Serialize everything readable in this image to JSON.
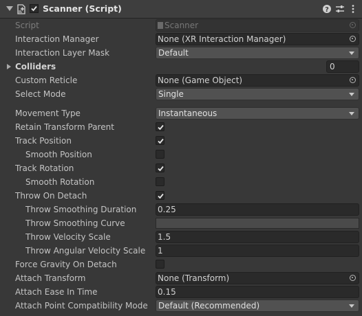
{
  "component": {
    "title": "Scanner (Script)",
    "enabled": true,
    "icon": "script-component-icon",
    "header_buttons": [
      "help-icon",
      "preset-icon",
      "context-menu-icon"
    ]
  },
  "rows": [
    {
      "name": "script",
      "label": "Script",
      "kind": "object",
      "value": "Scanner",
      "dim": true,
      "indent": 0
    },
    {
      "name": "interaction-manager",
      "label": "Interaction Manager",
      "kind": "object",
      "value": "None (XR Interaction Manager)",
      "indent": 0
    },
    {
      "name": "interaction-layer-mask",
      "label": "Interaction Layer Mask",
      "kind": "dropdown",
      "value": "Default",
      "indent": 0
    },
    {
      "name": "colliders",
      "label": "Colliders",
      "kind": "foldout",
      "value": "0",
      "indent": 0
    },
    {
      "name": "custom-reticle",
      "label": "Custom Reticle",
      "kind": "object",
      "value": "None (Game Object)",
      "indent": 0
    },
    {
      "name": "select-mode",
      "label": "Select Mode",
      "kind": "dropdown",
      "value": "Single",
      "indent": 0
    },
    {
      "name": "movement-type",
      "label": "Movement Type",
      "kind": "dropdown",
      "value": "Instantaneous",
      "indent": 0
    },
    {
      "name": "retain-transform-parent",
      "label": "Retain Transform Parent",
      "kind": "checkbox",
      "checked": true,
      "indent": 0
    },
    {
      "name": "track-position",
      "label": "Track Position",
      "kind": "checkbox",
      "checked": true,
      "indent": 0
    },
    {
      "name": "smooth-position",
      "label": "Smooth Position",
      "kind": "checkbox",
      "checked": false,
      "indent": 1
    },
    {
      "name": "track-rotation",
      "label": "Track Rotation",
      "kind": "checkbox",
      "checked": true,
      "indent": 0
    },
    {
      "name": "smooth-rotation",
      "label": "Smooth Rotation",
      "kind": "checkbox",
      "checked": false,
      "indent": 1
    },
    {
      "name": "throw-on-detach",
      "label": "Throw On Detach",
      "kind": "checkbox",
      "checked": true,
      "indent": 0
    },
    {
      "name": "throw-smoothing-duration",
      "label": "Throw Smoothing Duration",
      "kind": "text",
      "value": "0.25",
      "indent": 1
    },
    {
      "name": "throw-smoothing-curve",
      "label": "Throw Smoothing Curve",
      "kind": "curve",
      "indent": 1
    },
    {
      "name": "throw-velocity-scale",
      "label": "Throw Velocity Scale",
      "kind": "text",
      "value": "1.5",
      "indent": 1
    },
    {
      "name": "throw-angular-velocity-scale",
      "label": "Throw Angular Velocity Scale",
      "kind": "text",
      "value": "1",
      "indent": 1
    },
    {
      "name": "force-gravity-on-detach",
      "label": "Force Gravity On Detach",
      "kind": "checkbox",
      "checked": false,
      "indent": 0
    },
    {
      "name": "attach-transform",
      "label": "Attach Transform",
      "kind": "object",
      "value": "None (Transform)",
      "indent": 0
    },
    {
      "name": "attach-ease-in-time",
      "label": "Attach Ease In Time",
      "kind": "text",
      "value": "0.15",
      "indent": 0
    },
    {
      "name": "attach-point-compatibility-mode",
      "label": "Attach Point Compatibility Mode",
      "kind": "dropdown",
      "value": "Default (Recommended)",
      "indent": 0
    }
  ]
}
